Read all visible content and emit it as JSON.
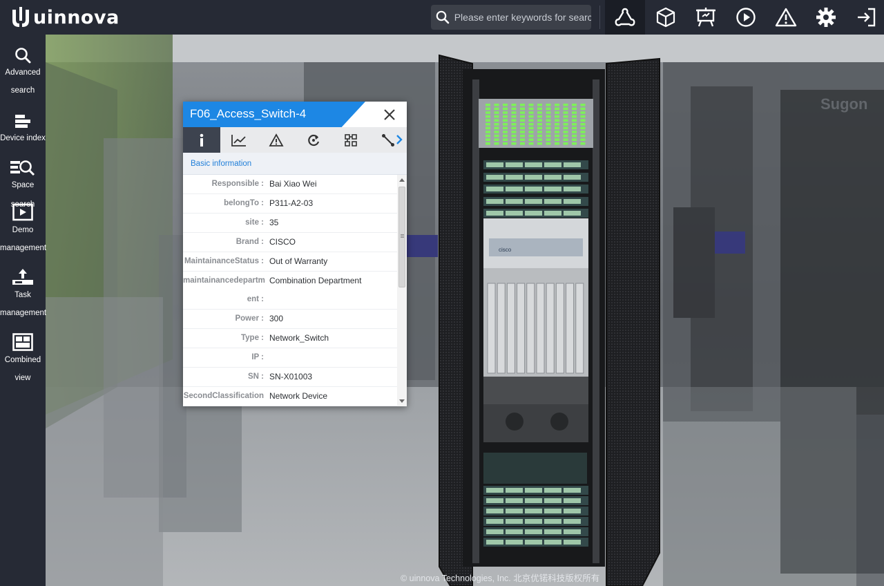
{
  "app": {
    "brand": "uinnova",
    "search_placeholder": "Please enter keywords for search"
  },
  "toolbar": {
    "tools": [
      {
        "icon": "network-topology-icon",
        "active": true
      },
      {
        "icon": "cube-icon",
        "active": false
      },
      {
        "icon": "presentation-icon",
        "active": false
      },
      {
        "icon": "play-icon",
        "active": false
      },
      {
        "icon": "warning-icon",
        "active": false
      },
      {
        "icon": "gear-icon",
        "active": false
      },
      {
        "icon": "logout-icon",
        "active": false
      }
    ]
  },
  "sidebar": {
    "items": [
      {
        "label": "Advanced search",
        "icon": "search-icon"
      },
      {
        "label": "Device index",
        "icon": "device-index-icon"
      },
      {
        "label": "Space search",
        "icon": "space-search-icon"
      },
      {
        "label": "Demo management",
        "icon": "demo-icon"
      },
      {
        "label": "Task management",
        "icon": "task-icon"
      },
      {
        "label": "Combined view",
        "icon": "combined-view-icon"
      }
    ]
  },
  "dialog": {
    "title": "F06_Access_Switch-4",
    "tabs": [
      {
        "icon": "info-icon",
        "active": true
      },
      {
        "icon": "line-chart-icon",
        "active": false
      },
      {
        "icon": "alert-icon",
        "active": false
      },
      {
        "icon": "refresh-icon",
        "active": false
      },
      {
        "icon": "topology-icon",
        "active": false
      },
      {
        "icon": "link-icon",
        "active": false
      }
    ],
    "section_title": "Basic information",
    "rows": [
      {
        "key": "Responsible :",
        "value": "Bai Xiao Wei"
      },
      {
        "key": "belongTo :",
        "value": "P311-A2-03"
      },
      {
        "key": "site :",
        "value": "35"
      },
      {
        "key": "Brand :",
        "value": "CISCO"
      },
      {
        "key": "MaintainanceStatus :",
        "value": "Out of Warranty"
      },
      {
        "key_line1": "maintainancedepartm",
        "key_line2": "ent :",
        "value": "Combination Department"
      },
      {
        "key": "Power :",
        "value": "300"
      },
      {
        "key": "Type :",
        "value": "Network_Switch"
      },
      {
        "key": "IP :",
        "value": ""
      },
      {
        "key": "SN :",
        "value": "SN-X01003"
      },
      {
        "key": "SecondClassification",
        "value": "Network Device"
      }
    ]
  },
  "scene": {
    "wall_logo": "Sugon",
    "rack_label": "cisco",
    "copyright": "© uinnova Technologies, Inc.   北京优锘科技版权所有"
  },
  "colors": {
    "topbar": "#262a35",
    "accent": "#1d87e4",
    "section_text": "#1f7ed8",
    "led_green": "#7ef05a"
  }
}
